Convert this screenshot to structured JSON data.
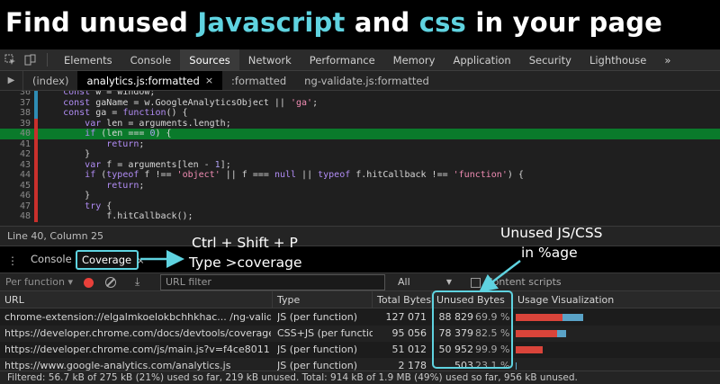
{
  "headline": {
    "part1": "Find unused ",
    "highlight1": "Javascript",
    "part2": " and ",
    "highlight2": "css",
    "part3": " in your page"
  },
  "devtools_tabs": [
    {
      "label": "Elements"
    },
    {
      "label": "Console"
    },
    {
      "label": "Sources",
      "active": true
    },
    {
      "label": "Network"
    },
    {
      "label": "Performance"
    },
    {
      "label": "Memory"
    },
    {
      "label": "Application"
    },
    {
      "label": "Security"
    },
    {
      "label": "Lighthouse"
    }
  ],
  "devtools_overflow": "»",
  "file_tabs": {
    "index": "(index)",
    "active": "analytics.js:formatted",
    "active_close": "×",
    "second": ":formatted",
    "third": "ng-validate.js:formatted"
  },
  "code_lines": [
    {
      "num": "36",
      "text": "    const w = window;",
      "coverage": "used"
    },
    {
      "num": "37",
      "text": "    const gaName = w.GoogleAnalyticsObject || 'ga';",
      "coverage": "used"
    },
    {
      "num": "38",
      "text": "    const ga = function() {",
      "coverage": "used"
    },
    {
      "num": "39",
      "text": "        var len = arguments.length;",
      "coverage": "unused"
    },
    {
      "num": "40",
      "text": "        if (len === 0) {",
      "coverage": "unused",
      "highlight": true
    },
    {
      "num": "41",
      "text": "            return;",
      "coverage": "unused"
    },
    {
      "num": "42",
      "text": "        }",
      "coverage": "unused"
    },
    {
      "num": "43",
      "text": "        var f = arguments[len - 1];",
      "coverage": "unused"
    },
    {
      "num": "44",
      "text": "        if (typeof f !== 'object' || f === null || typeof f.hitCallback !== 'function') {",
      "coverage": "unused"
    },
    {
      "num": "45",
      "text": "            return;",
      "coverage": "unused"
    },
    {
      "num": "46",
      "text": "        }",
      "coverage": "unused"
    },
    {
      "num": "47",
      "text": "        try {",
      "coverage": "unused"
    },
    {
      "num": "48",
      "text": "            f.hitCallback();",
      "coverage": "unused"
    }
  ],
  "status": {
    "position": "Line 40, Column 25"
  },
  "drawer": {
    "menu_icon": "⋮",
    "console_tab": "Console",
    "coverage_tab": "Coverage",
    "coverage_close": "×"
  },
  "annotations": {
    "shortcut": "Ctrl + Shift + P",
    "type_cmd": "Type >coverage",
    "unused_line1": "Unused JS/CSS",
    "unused_line2": "in %age"
  },
  "toolbar": {
    "per_function": "Per function ▾",
    "url_filter_placeholder": "URL filter",
    "type_select": "All",
    "type_caret": "▼",
    "content_scripts": "Content scripts"
  },
  "table": {
    "headers": {
      "url": "URL",
      "type": "Type",
      "total": "Total Bytes",
      "unused": "Unused Bytes",
      "vis": "Usage Visualization"
    },
    "rows": [
      {
        "url": "chrome-extension://elgalmkoelokbchhkhac... /ng-validate.js",
        "type": "JS (per function)",
        "total": "127 071",
        "unused": "88 829",
        "pct": "69.9 %",
        "unused_frac": 0.699,
        "total_frac": 1.0
      },
      {
        "url": "https://developer.chrome.com/docs/devtools/coverage/",
        "type": "CSS+JS (per function)",
        "total": "95 056",
        "unused": "78 379",
        "pct": "82.5 %",
        "unused_frac": 0.825,
        "total_frac": 0.748
      },
      {
        "url": "https://developer.chrome.com/js/main.js?v=f4ce8011",
        "type": "JS (per function)",
        "total": "51 012",
        "unused": "50 952",
        "pct": "99.9 %",
        "unused_frac": 0.999,
        "total_frac": 0.401
      },
      {
        "url": "https://www.google-analytics.com/analytics.js",
        "type": "JS (per function)",
        "total": "2 178",
        "unused": "503",
        "pct": "23.1 %",
        "unused_frac": 0.231,
        "total_frac": 0.017
      }
    ]
  },
  "footer": "Filtered: 56.7 kB of 275 kB (21%) used so far, 219 kB unused. Total: 914 kB of 1.9 MB (49%) used so far, 956 kB unused.",
  "colors": {
    "accent": "#5fd3e0",
    "used": "#2f8db5",
    "unused": "#c9302c",
    "highlight_line": "#0a7a2b"
  }
}
